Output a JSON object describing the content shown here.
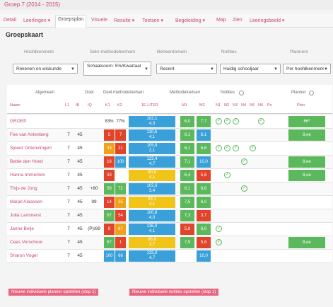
{
  "header": {
    "title": "Groep 7 (2014 - 2015)"
  },
  "nav": [
    {
      "label": "Detail"
    },
    {
      "label": "Leerlingen ▾"
    },
    {
      "label": "Groepsplan"
    },
    {
      "label": "Visuele"
    },
    {
      "label": "Resulte ▾"
    },
    {
      "label": "Toetsen ▾"
    },
    {
      "label": "Begeleiding ▾"
    },
    {
      "label": "Map"
    },
    {
      "label": "Zien"
    },
    {
      "label": "Leeringsbeeld ▾"
    }
  ],
  "page": {
    "title": "Groepskaart"
  },
  "filters": {
    "labels": [
      "Hoofdkenmerk",
      "Sekr-methodebenham",
      "Beheerdomein",
      "Notities",
      "Planners"
    ],
    "selects": [
      "Rekenen en wiskunde",
      "Schaalsoorn: 5%/Kwartaal",
      "Recent",
      "Huidig schooljaar",
      "Per hoofdkenmerk"
    ]
  },
  "table": {
    "groups": [
      "Algemeen",
      "Doel",
      "Deel methodetoetsen",
      "Methodetoetsen",
      "Notities",
      "Planner"
    ],
    "subheaders": [
      "Naam",
      "L1",
      "IB",
      "IQ",
      "K1",
      "K2",
      "1E LITER",
      "M1",
      "M2",
      "N1",
      "N2",
      "N3",
      "N4",
      "N5",
      "N6",
      "Ps",
      "Plan"
    ],
    "group_row": {
      "name": "GROEP",
      "d1": "83%",
      "d2": "77%",
      "score": "102,1",
      "score_sub": "4,3",
      "m1": "6,0",
      "m2": "7,7",
      "plan": "66*"
    },
    "rows": [
      {
        "name": "Fee van Anlenberg",
        "l1": "7",
        "ib": "45",
        "iq": "",
        "d1": "5",
        "d2": "7",
        "score": "110,6",
        "score_sub": "4,1",
        "m1": "6,1",
        "m2": "6,1",
        "plan": "8,ee"
      },
      {
        "name": "Sjoerd Ontenvlingen",
        "l1": "7",
        "ib": "45",
        "iq": "",
        "d1": "33",
        "d2": "21",
        "score": "105,8",
        "score_sub": "2,1",
        "m1": "6,1",
        "m2": "6,6",
        "plan": ""
      },
      {
        "name": "Bettie den Hoed",
        "l1": "7",
        "ib": "45",
        "iq": "",
        "d1": "16",
        "d2": "100",
        "score": "123,4",
        "score_sub": "4,7",
        "m1": "7,1",
        "m2": "10,0",
        "plan": "8,ee"
      },
      {
        "name": "Hanna Immerlom",
        "l1": "7",
        "ib": "45",
        "iq": "",
        "d1": "33",
        "d2": "",
        "score": "90,8",
        "score_sub": "4,1",
        "m1": "6,4",
        "m2": "5,8",
        "plan": "8,ee"
      },
      {
        "name": "Thijs de Jong",
        "l1": "7",
        "ib": "45",
        "iq": "+80",
        "d1": "56",
        "d2": "72",
        "score": "102,6",
        "score_sub": "3,4",
        "m1": "6,1",
        "m2": "6,6",
        "plan": ""
      },
      {
        "name": "Marjel Alaassen",
        "l1": "7",
        "ib": "45",
        "iq": "99",
        "d1": "14",
        "d2": "35",
        "score": "93,1",
        "score_sub": "4,1",
        "m1": "7,5",
        "m2": "6,0",
        "plan": ""
      },
      {
        "name": "Julia Lammerst",
        "l1": "7",
        "ib": "45",
        "iq": "",
        "d1": "67",
        "d2": "54",
        "score": "100,8",
        "score_sub": "4,0",
        "m1": "7,3",
        "m2": "3,7",
        "plan": ""
      },
      {
        "name": "Janne Belje",
        "l1": "7",
        "ib": "45",
        "iq": "(P)/89",
        "d1": "8",
        "d2": "67",
        "score": "116,0",
        "score_sub": "4,1",
        "m1": "5,8",
        "m2": "6,0",
        "plan": ""
      },
      {
        "name": "Cees Verschoor",
        "l1": "7",
        "ib": "45",
        "iq": "",
        "d1": "67",
        "d2": "1",
        "score": "96,8",
        "score_sub": "3,7",
        "m1": "7,9",
        "m2": "5,8",
        "plan": "8,ee"
      },
      {
        "name": "Sharon Vogel",
        "l1": "7",
        "ib": "45",
        "iq": "",
        "d1": "100",
        "d2": "66",
        "score": "133,0",
        "score_sub": "4,7",
        "m1": "",
        "m2": "10,0",
        "plan": ""
      }
    ]
  },
  "footer": {
    "btn1": "Nieuwe individuele planner opstellen (stap 1)",
    "btn2": "Nieuwe individuele notities opstellen (stap 1)"
  }
}
